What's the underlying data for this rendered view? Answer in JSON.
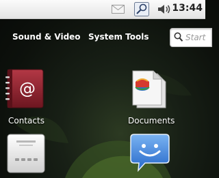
{
  "statusbar": {
    "clock": "13:44",
    "icons": [
      "mail-icon",
      "network-icon",
      "volume-icon"
    ]
  },
  "categories": {
    "sound_video": "Sound & Video",
    "system_tools": "System Tools"
  },
  "search": {
    "placeholder": "Start"
  },
  "apps": [
    {
      "label": "Contacts",
      "icon": "contacts-book-icon"
    },
    {
      "label": "Documents",
      "icon": "documents-icon"
    },
    {
      "label": "",
      "icon": "device-icon"
    },
    {
      "label": "",
      "icon": "chat-bubble-icon"
    }
  ],
  "colors": {
    "statusbar_bg": "#eeeeee",
    "contacts_red": "#8e1f2a",
    "chat_blue": "#3a82e0",
    "background": "#0d110c"
  }
}
